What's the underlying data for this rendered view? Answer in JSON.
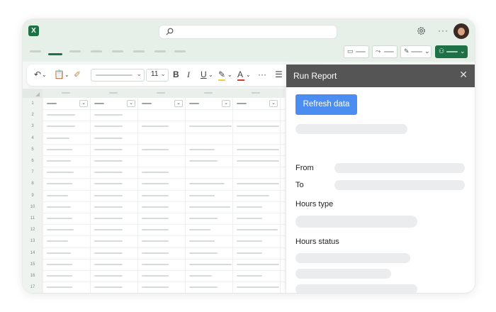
{
  "app": {
    "logo": "X",
    "more": "···"
  },
  "toolbar": {
    "font_size": "11",
    "bold": "B",
    "italic": "I",
    "underline": "U",
    "font_color": "A",
    "more": "···"
  },
  "grid": {
    "row_numbers": [
      "1",
      "2",
      "3",
      "4",
      "5",
      "6",
      "7",
      "8",
      "9",
      "10",
      "11",
      "12",
      "13",
      "14",
      "15",
      "16",
      "17"
    ]
  },
  "panel": {
    "title": "Run Report",
    "close": "✕",
    "refresh_label": "Refresh data",
    "from_label": "From",
    "to_label": "To",
    "hours_type_label": "Hours type",
    "hours_status_label": "Hours status"
  },
  "colors": {
    "excel_green": "#1e7145",
    "panel_header": "#555555",
    "refresh_button": "#4b8df1"
  },
  "icons": [
    "excel-logo-icon",
    "search-icon",
    "gear-icon",
    "more-icon",
    "avatar",
    "comment-icon",
    "share-icon",
    "edit-icon",
    "user-icon",
    "undo-icon",
    "paste-icon",
    "format-painter-icon",
    "highlight-icon",
    "font-color-icon",
    "close-icon"
  ]
}
